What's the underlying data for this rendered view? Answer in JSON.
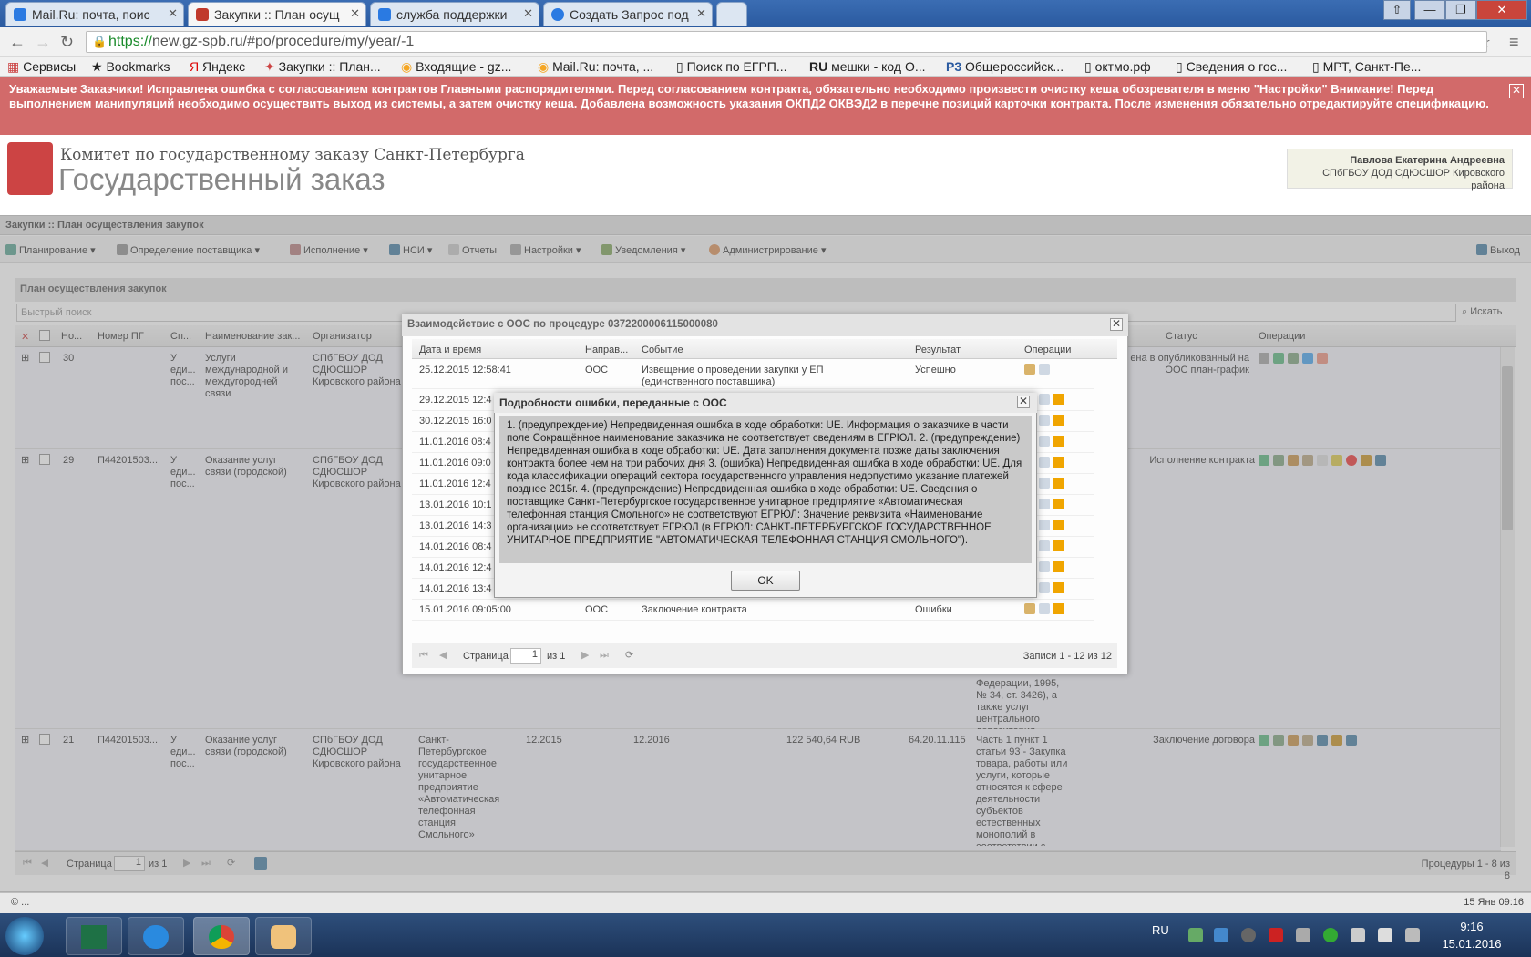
{
  "browser": {
    "tabs": [
      {
        "label": "Mail.Ru: почта, поис",
        "color": "#f5a623"
      },
      {
        "label": "Закупки :: План осущ",
        "color": "#c0392b"
      },
      {
        "label": "служба поддержки",
        "color": "#2a7ae2"
      },
      {
        "label": "Создать Запрос под",
        "color": "#2a7ae2"
      }
    ],
    "url_scheme": "https://",
    "url_rest": "new.gz-spb.ru/#po/procedure/my/year/-1",
    "bookmarks": [
      "Сервисы",
      "Bookmarks",
      "Яндекс",
      "Закупки :: План...",
      "Входящие - gz...",
      "Mail.Ru: почта, ...",
      "Поиск по ЕГРП...",
      "мешки - код О...",
      "Общероссийск...",
      "октмо.рф",
      "Сведения о гос...",
      "МРТ, Санкт-Пе..."
    ]
  },
  "alert": {
    "text": "Уважаемые Заказчики! Исправлена ошибка с согласованием контрактов Главными распорядителями. Перед согласованием контракта, обязательно необходимо произвести очистку кеша обозревателя в меню \"Настройки\" Внимание! Перед выполнением манипуляций необходимо осуществить выход из системы, а затем очистку кеша. Добавлена возможность указания ОКПД2 ОКВЭД2 в перечне позиций карточки контракта. После изменения обязательно отредактируйте спецификацию.",
    "close": "✕"
  },
  "header": {
    "org": "Комитет по государственному заказу Санкт-Петербурга",
    "title": "Государственный заказ",
    "user_name": "Павлова Екатерина Андреевна",
    "user_org": "СПбГБОУ ДОД СДЮСШОР Кировского района"
  },
  "app": {
    "breadcrumb": "Закупки :: План осуществления закупок",
    "menu": [
      "Планирование",
      "Определение поставщика",
      "Исполнение",
      "НСИ",
      "Отчеты",
      "Настройки",
      "Уведомления",
      "Администрирование"
    ],
    "exit": "Выход"
  },
  "panel": {
    "title": "План осуществления закупок",
    "quick_search_placeholder": "Быстрый поиск",
    "search_button": "Искать",
    "columns": [
      "Но...",
      "Номер ПГ",
      "Сп...",
      "Наименование зак...",
      "Организатор",
      "Статус",
      "Операции"
    ],
    "rows": [
      {
        "no": "30",
        "pg": "",
        "sp": "У еди... пос...",
        "name": "Услуги международной и междугородней связи",
        "org": "СПбГБОУ ДОД СДЮСШОР Кировского района",
        "status": "ена в опубликованный на ООС план-график"
      },
      {
        "no": "29",
        "pg": "П44201503...",
        "sp": "У еди... пос...",
        "name": "Оказание услуг связи (городской)",
        "org": "СПбГБОУ ДОД СДЮСШОР Кировского района",
        "status": "Исполнение контракта"
      },
      {
        "no": "21",
        "pg": "П44201503...",
        "sp": "У еди... пос...",
        "name": "Оказание услуг связи (городской)",
        "org": "СПбГБОУ ДОД СДЮСШОР Кировского района",
        "supplier": "Санкт-Петербургское государственное унитарное предприятие «Автоматическая телефонная станция Смольного»",
        "start": "12.2015",
        "end": "12.2016",
        "sum": "122 540,64 RUB",
        "okpd": "64.20.11.115",
        "basis": "Часть 1 пункт 1 статьи 93 - Закупка товара, работы или услуги, которые относятся к сфере деятельности субъектов естественных монополий в соответствии с",
        "status": "Заключение договора"
      }
    ],
    "row29_basis_tail": "Федерации, 1995, № 34, ст. 3426), а также услуг центрального депозитария",
    "page_label": "Страница",
    "page_value": "1",
    "page_of": "из 1",
    "records": "Процедуры 1 - 8 из 8"
  },
  "dialog1": {
    "title": "Взаимодействие с ООС по процедуре 0372200006115000080",
    "columns": [
      "Дата и время",
      "Направ...",
      "Событие",
      "Результат",
      "Операции"
    ],
    "rows": [
      {
        "date": "25.12.2015 12:58:41",
        "dir": "ООС",
        "event": "Извещение о проведении закупки у ЕП (единственного поставщика)",
        "result": "Успешно"
      },
      {
        "date": "29.12.2015 12:4",
        "dir": "",
        "event": "",
        "result": ""
      },
      {
        "date": "30.12.2015 16:0",
        "dir": "",
        "event": "",
        "result": ""
      },
      {
        "date": "11.01.2016 08:4",
        "dir": "",
        "event": "",
        "result": ""
      },
      {
        "date": "11.01.2016 09:0",
        "dir": "",
        "event": "",
        "result": ""
      },
      {
        "date": "11.01.2016 12:4",
        "dir": "",
        "event": "",
        "result": ""
      },
      {
        "date": "13.01.2016 10:1",
        "dir": "",
        "event": "",
        "result": ""
      },
      {
        "date": "13.01.2016 14:3",
        "dir": "",
        "event": "",
        "result": ""
      },
      {
        "date": "14.01.2016 08:4",
        "dir": "",
        "event": "",
        "result": ""
      },
      {
        "date": "14.01.2016 12:4",
        "dir": "",
        "event": "",
        "result": ""
      },
      {
        "date": "14.01.2016 13:4",
        "dir": "",
        "event": "",
        "result": ""
      },
      {
        "date": "15.01.2016 09:05:00",
        "dir": "ООС",
        "event": "Заключение контракта",
        "result": "Ошибки"
      }
    ],
    "page_label": "Страница",
    "page_value": "1",
    "page_of": "из 1",
    "records": "Записи 1 - 12 из 12"
  },
  "dialog2": {
    "title": "Подробности ошибки, переданные с ООС",
    "body": "1. (предупреждение) Непредвиденная ошибка в ходе обработки: UE. Информация о заказчике в части поле Сокращённое наименование заказчика не соответствует сведениям в ЕГРЮЛ. 2. (предупреждение) Непредвиденная ошибка в ходе обработки: UE. Дата заполнения документа позже даты заключения контракта более чем на три рабочих дня 3. (ошибка) Непредвиденная ошибка в ходе обработки: UE. Для кода классификации операций сектора государственного управления недопустимо указание платежей позднее 2015г. 4. (предупреждение) Непредвиденная ошибка в ходе обработки: UE. Сведения о поставщике Санкт-Петербургское государственное унитарное предприятие «Автоматическая телефонная станция Смольного» не соответствуют ЕГРЮЛ: Значение реквизита «Наименование организации» не соответствует ЕГРЮЛ (в ЕГРЮЛ: САНКТ-ПЕТЕРБУРГСКОЕ ГОСУДАРСТВЕННОЕ УНИТАРНОЕ ПРЕДПРИЯТИЕ \"АВТОМАТИЧЕСКАЯ ТЕЛЕФОННАЯ СТАНЦИЯ СМОЛЬНОГО\").",
    "ok": "OK"
  },
  "statusbar": {
    "left": "© ...",
    "right": "15 Янв 09:16"
  },
  "taskbar": {
    "lang": "RU",
    "time": "9:16",
    "date": "15.01.2016"
  },
  "colors": {
    "alert": "#d26a6a",
    "warn": "#f0a500",
    "accent": "#2a5aa0"
  }
}
